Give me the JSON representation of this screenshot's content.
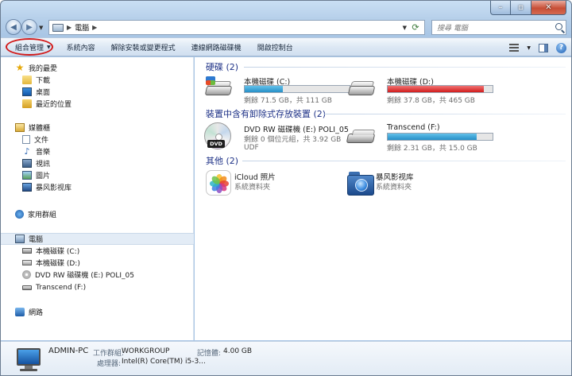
{
  "address": {
    "location": "電腦"
  },
  "search": {
    "placeholder": "搜尋 電腦"
  },
  "toolbar": {
    "organize": "組合管理",
    "items": [
      "系統內容",
      "解除安裝或變更程式",
      "連線網路磁碟機",
      "開啟控制台"
    ]
  },
  "sidebar": {
    "favorites": {
      "label": "我的最愛",
      "items": [
        "下載",
        "桌面",
        "最近的位置"
      ]
    },
    "libraries": {
      "label": "媒體櫃",
      "items": [
        "文件",
        "音樂",
        "視訊",
        "圖片",
        "暴风影视库"
      ]
    },
    "homegroup": "家用群組",
    "computer": {
      "label": "電腦",
      "items": [
        "本機磁碟 (C:)",
        "本機磁碟 (D:)",
        "DVD RW 磁碟機 (E:) POLI_05",
        "Transcend (F:)"
      ]
    },
    "network": "網路"
  },
  "content": {
    "hdd_group": "硬碟 (2)",
    "removable_group": "裝置中含有卸除式存放裝置 (2)",
    "other_group": "其他 (2)",
    "drive_c": {
      "name": "本機磁碟 (C:)",
      "free": "剩餘 71.5 GB，共 111 GB",
      "used_fraction": 0.36
    },
    "drive_d": {
      "name": "本機磁碟 (D:)",
      "free": "剩餘 37.8 GB，共 465 GB",
      "used_fraction": 0.92
    },
    "drive_e": {
      "name": "DVD RW 磁碟機 (E:) POLI_05",
      "free": "剩餘 0 個位元組，共 3.92 GB",
      "fs": "UDF",
      "badge": "DVD"
    },
    "drive_f": {
      "name": "Transcend (F:)",
      "free": "剩餘 2.31 GB，共 15.0 GB",
      "used_fraction": 0.85
    },
    "icloud": {
      "name": "iCloud 照片",
      "type": "系統資料夾"
    },
    "storm": {
      "name": "暴风影视库",
      "type": "系統資料夾"
    }
  },
  "details": {
    "pc_name": "ADMIN-PC",
    "workgroup_label": "工作群組:",
    "workgroup": "WORKGROUP",
    "memory_label": "記憶體:",
    "memory": "4.00 GB",
    "cpu_label": "處理器:",
    "cpu": "Intel(R) Core(TM) i5-3..."
  },
  "colors": {
    "accent_group": "#1e3287",
    "bar_normal": "#268fc7",
    "bar_full": "#d11b1b",
    "highlight_ring": "#d21c1c"
  }
}
